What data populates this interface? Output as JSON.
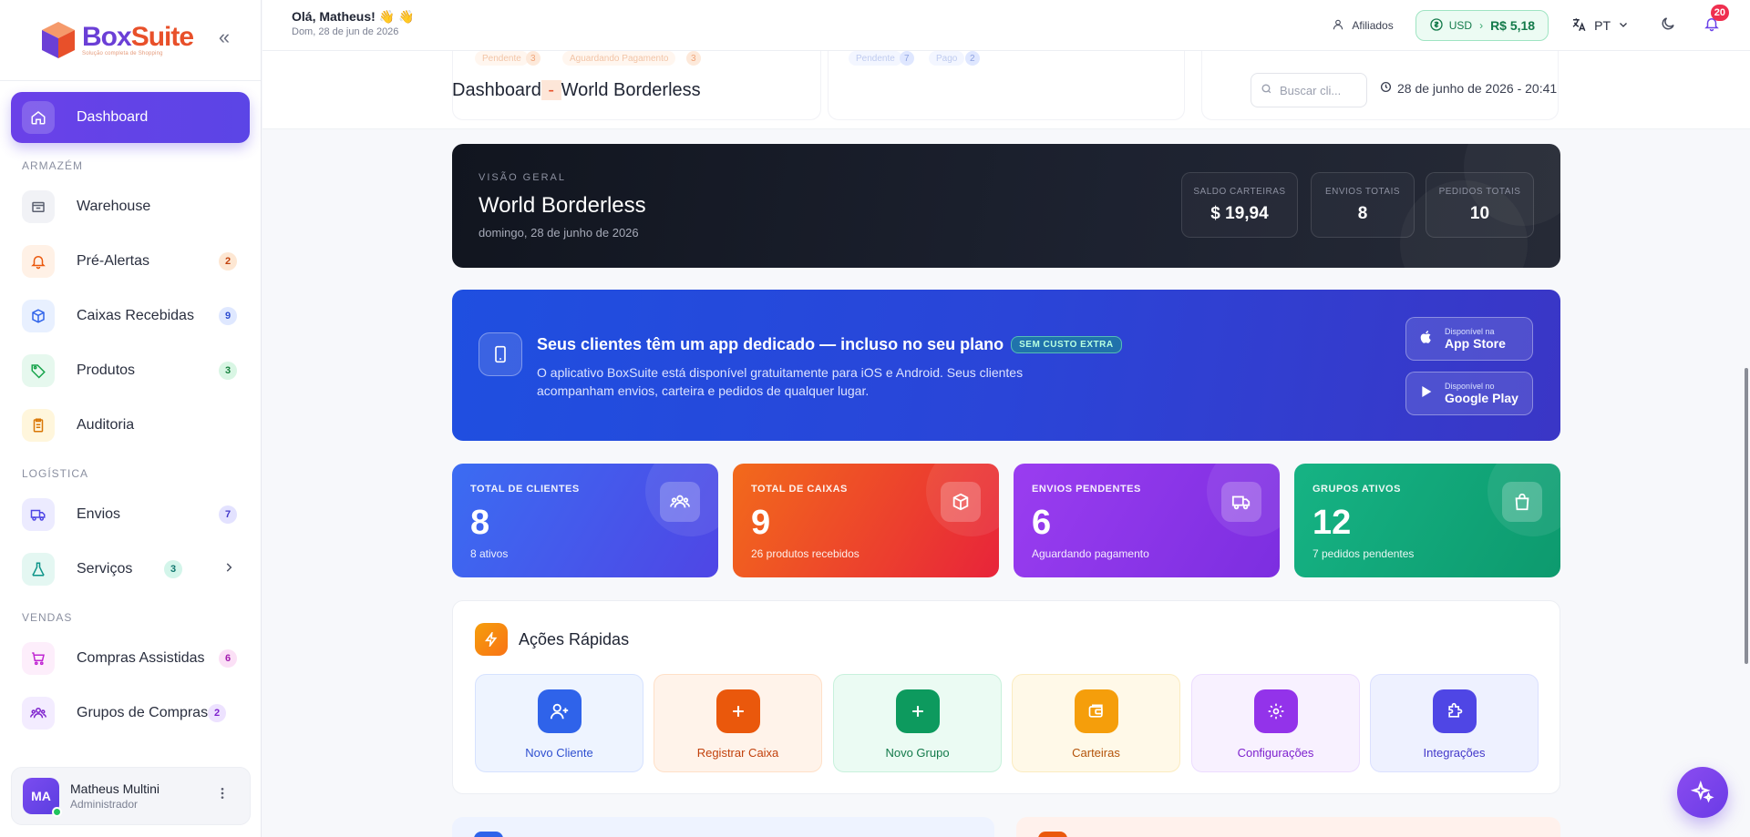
{
  "brand": {
    "name_part1": "Box",
    "name_part2": "Suite",
    "tagline": "Solução completa de Shopping"
  },
  "sidebar": {
    "collapse_glyph": "«",
    "dashboard": "Dashboard",
    "sections": [
      {
        "label": "ARMAZÉM",
        "items": [
          {
            "label": "Warehouse",
            "badge": ""
          },
          {
            "label": "Pré-Alertas",
            "badge": "2"
          },
          {
            "label": "Caixas Recebidas",
            "badge": "9"
          },
          {
            "label": "Produtos",
            "badge": "3"
          },
          {
            "label": "Auditoria",
            "badge": ""
          }
        ]
      },
      {
        "label": "LOGÍSTICA",
        "items": [
          {
            "label": "Envios",
            "badge": "7"
          },
          {
            "label": "Serviços",
            "badge": "3"
          }
        ]
      },
      {
        "label": "VENDAS",
        "items": [
          {
            "label": "Compras Assistidas",
            "badge": "6"
          },
          {
            "label": "Grupos de Compras",
            "badge": "2"
          }
        ]
      }
    ],
    "user": {
      "initials": "MA",
      "name": "Matheus Multini",
      "role": "Administrador"
    }
  },
  "header": {
    "greeting": "Olá, Matheus! 👋 👋",
    "date": "Dom, 28 de jun de 2026",
    "affiliates": "Afiliados",
    "currency": "USD",
    "rate": "R$ 5,18",
    "language": "PT",
    "notifications": "20"
  },
  "title_bar": {
    "ghost_chips": [
      "Pendente",
      "3",
      "Aguardando Pagamento",
      "3",
      "Pendente",
      "7",
      "Pago",
      "2"
    ],
    "title_prefix": "Dashboard",
    "title_dash": " - ",
    "title_name": "World Borderless",
    "search_placeholder": "Buscar cli...",
    "datetime": "28 de junho de 2026 - 20:41"
  },
  "hero": {
    "kicker": "VISÃO GERAL",
    "title": "World Borderless",
    "subtitle": "domingo, 28 de junho de 2026",
    "stats": [
      {
        "label": "SALDO CARTEIRAS",
        "value": "$ 19,94"
      },
      {
        "label": "ENVIOS TOTAIS",
        "value": "8"
      },
      {
        "label": "PEDIDOS TOTAIS",
        "value": "10"
      }
    ]
  },
  "app_banner": {
    "title": "Seus clientes têm um app dedicado — incluso no seu plano",
    "badge": "SEM CUSTO EXTRA",
    "description": "O aplicativo BoxSuite está disponível gratuitamente para iOS e Android. Seus clientes acompanham envios, carteira e pedidos de qualquer lugar.",
    "app_store_small": "Disponível na",
    "app_store_big": "App Store",
    "google_small": "Disponível no",
    "google_big": "Google Play"
  },
  "stats": [
    {
      "label": "TOTAL DE CLIENTES",
      "value": "8",
      "sub": "8 ativos",
      "color_from": "#3b6cf2",
      "color_to": "#4f46e5"
    },
    {
      "label": "TOTAL DE CAIXAS",
      "value": "9",
      "sub": "26 produtos recebidos",
      "color_from": "#f26a1b",
      "color_to": "#e8243a"
    },
    {
      "label": "ENVIOS PENDENTES",
      "value": "6",
      "sub": "Aguardando pagamento",
      "color_from": "#9a3df0",
      "color_to": "#7c2ee0"
    },
    {
      "label": "GRUPOS ATIVOS",
      "value": "12",
      "sub": "7 pedidos pendentes",
      "color_from": "#16b384",
      "color_to": "#0d9a6e"
    }
  ],
  "quick_actions": {
    "title": "Ações Rápidas",
    "items": [
      {
        "label": "Novo Cliente",
        "bg": "#eef4ff",
        "border": "#d6e2ff",
        "btn": "#2f63ea",
        "text": "#2f4fd0"
      },
      {
        "label": "Registrar Caixa",
        "bg": "#fff3ea",
        "border": "#ffe0c8",
        "btn": "#ea580c",
        "text": "#c2410c"
      },
      {
        "label": "Novo Grupo",
        "bg": "#ebfbf3",
        "border": "#c8f1dc",
        "btn": "#0d9a5e",
        "text": "#137a4a"
      },
      {
        "label": "Carteiras",
        "bg": "#fff9e8",
        "border": "#fbecc0",
        "btn": "#f59e0b",
        "text": "#b45309"
      },
      {
        "label": "Configurações",
        "bg": "#f8f1ff",
        "border": "#ecdcff",
        "btn": "#9333ea",
        "text": "#7e22ce"
      },
      {
        "label": "Integrações",
        "bg": "#eef1ff",
        "border": "#dbe0ff",
        "btn": "#4f46e5",
        "text": "#4338ca"
      }
    ]
  }
}
